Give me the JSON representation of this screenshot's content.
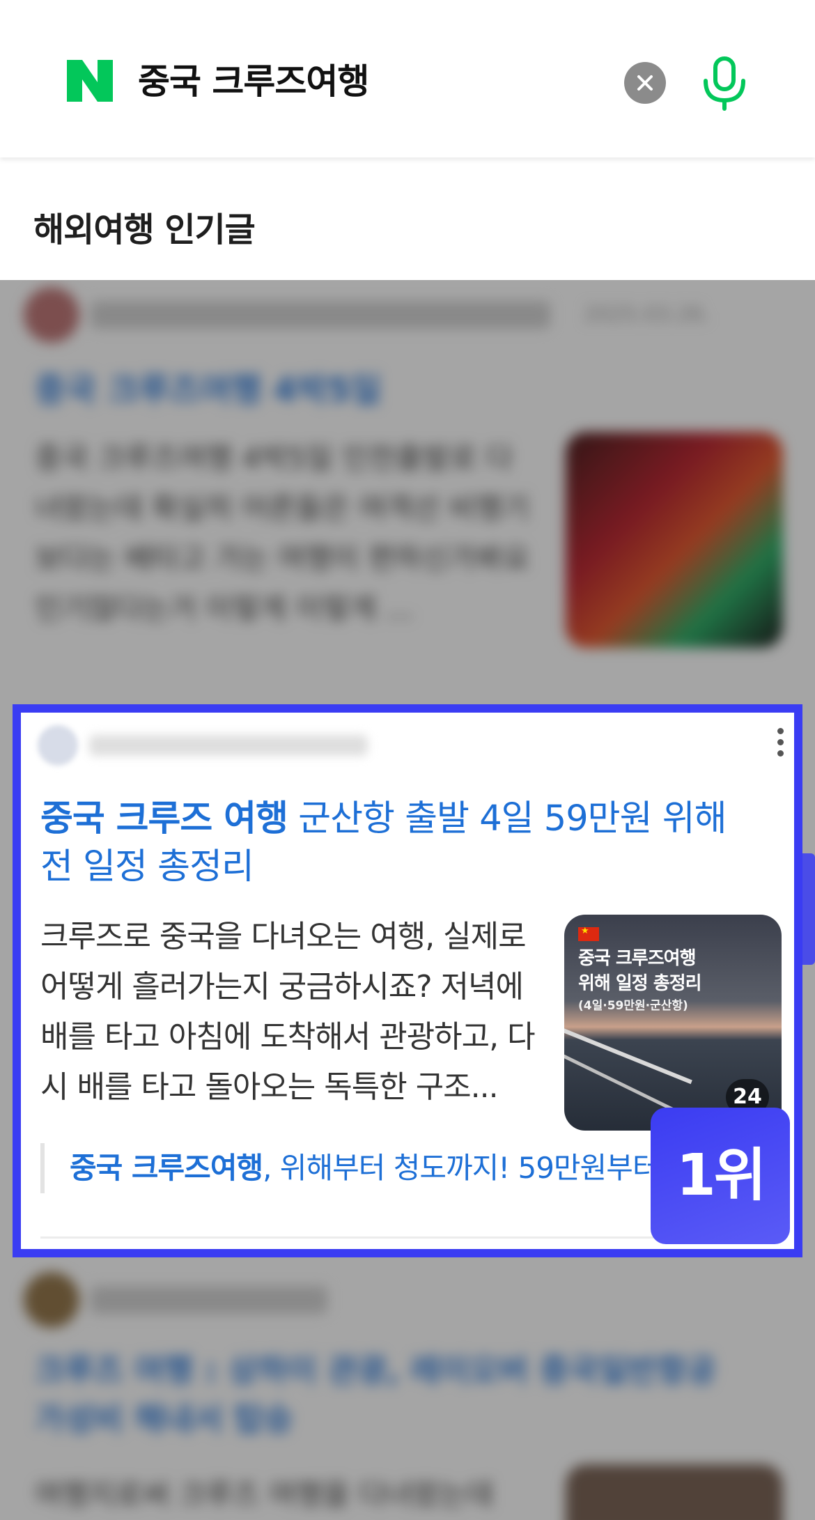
{
  "search": {
    "query": "중국 크루즈여행",
    "logo_letter": "N",
    "brand_color": "#03c75a"
  },
  "section": {
    "title": "해외여행 인기글"
  },
  "blurred_post_top": {
    "title": "중국 크루즈여행 4박5일",
    "snippet": "중국 크루즈여행 4박5일 인천출발로 다녀왔는데 확실히 어른들은 여객선 비행기보다는 배타고 가는 여행이 편하신가봐요 인기많다는거 이렇게 이렇게 ...",
    "date": "2025.03.26."
  },
  "featured_post": {
    "title_keyword": "중국 크루즈 여행",
    "title_rest": " 군산항 출발 4일 59만원 위해 전 일정 총정리",
    "snippet": "크루즈로 중국을 다녀오는 여행, 실제로 어떻게 흘러가는지 궁금하시죠? 저녁에 배를 타고 아침에 도착해서 관광하고, 다시 배를 타고 돌아오는 독특한 구조...",
    "thumbnail": {
      "line1": "중국 크루즈여행",
      "line2": "위해 일정 총정리",
      "line3": "(4일·59만원·군산항)",
      "image_count": "24"
    },
    "related": {
      "keyword": "중국 크루즈여행",
      "rest": ", 위해부터 청도까지! 59만원부터"
    },
    "rank": "1위"
  },
  "blurred_post_bottom": {
    "title": "크루즈 여행 : 상하이 관광, 레이오버 중국일반항공 가성비 해내서 탑승",
    "snippet": "여행지로써 크루즈 여행을 다녀왔는데"
  },
  "colors": {
    "highlight_border": "#3a3cf3",
    "link_blue": "#1d6fd6",
    "clear_button": "#8b8b8b"
  }
}
